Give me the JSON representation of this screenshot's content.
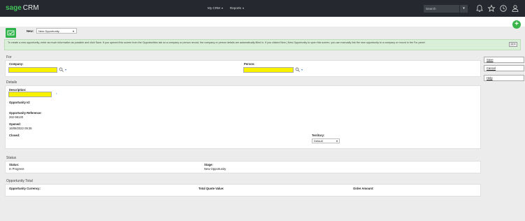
{
  "app": {
    "logo_brand": "sage",
    "logo_product": "CRM"
  },
  "nav": [
    {
      "label": "My CRM",
      "caret": "▾"
    },
    {
      "label": "Reports",
      "caret": "▾"
    }
  ],
  "search": {
    "placeholder": "Search",
    "go_glyph": "▾"
  },
  "icons": {
    "accent": "#41c35a",
    "add": "+"
  },
  "new_row": {
    "label": "New:",
    "selected": "New Opportunity",
    "caret": "▾"
  },
  "banner": {
    "text": "To create a new opportunity, enter as much information as possible and click Save. If you opened this screen from the Opportunities tab on a company or person record, the company or person details are automatically filled in. If you clicked New | New Opportunity to open this screen, you can manually link the new opportunity to a company or record in the For panel.",
    "close_label": "[x] A"
  },
  "sections": {
    "for": {
      "title": "For",
      "company_label": "Company:",
      "person_label": "Person:"
    },
    "details": {
      "title": "Details",
      "description_label": "Description:",
      "description_marker": "*",
      "opportunity_id_label": "Opportunity Id:",
      "reference_label": "Opportunity Reference:",
      "reference_value": "262-96130",
      "opened_label": "Opened:",
      "opened_value": "16/08/2022 09:35",
      "closed_label": "Closed:",
      "territory_label": "Territory:",
      "territory_value": "Default"
    },
    "status": {
      "title": "Status",
      "status_label": "Status:",
      "status_value": "In Progress",
      "stage_label": "Stage:",
      "stage_value": "New Opportunity"
    },
    "total": {
      "title": "Opportunity Total",
      "currency_label": "Opportunity Currency:",
      "quote_label": "Total Quote Value:",
      "order_label": "Order Amount:"
    }
  },
  "buttons": {
    "save": "Save",
    "cancel": "Cancel",
    "help": "Help"
  },
  "dropdown_glyph": "▾"
}
